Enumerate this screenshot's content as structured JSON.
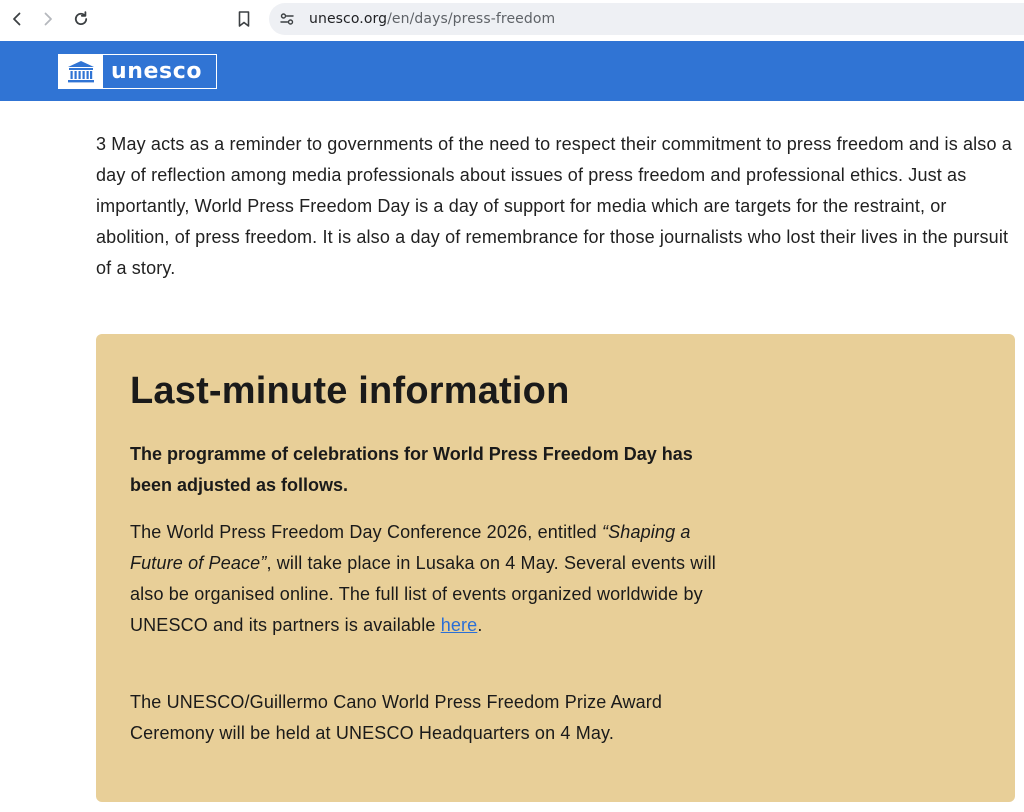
{
  "browser": {
    "url_domain": "unesco.org",
    "url_path": "/en/days/press-freedom"
  },
  "header": {
    "logo_text": "unesco",
    "brand_color": "#3074d4"
  },
  "intro": {
    "text": "3 May acts as a reminder to governments of the need to respect their commitment to press freedom and is also a day of reflection among media professionals about issues of press freedom and professional ethics. Just as importantly, World Press Freedom Day is a day of support for media which are targets for the restraint, or abolition, of press freedom. It is also a day of remembrance for those journalists who lost their lives in the pursuit of a story."
  },
  "info": {
    "background_color": "#e8cf98",
    "title": "Last-minute information",
    "lead": "The programme of celebrations for World Press Freedom Day has been adjusted as follows.",
    "p1_before": "The World Press Freedom Day Conference 2026, entitled ",
    "p1_emphasis": "“Shaping a Future of Peace”",
    "p1_after": ", will take place in Lusaka on 4 May. Several events will also be organised online. The full list of events organized worldwide by UNESCO and its partners is available ",
    "p1_link": "here",
    "p1_end": ".",
    "p2": "The UNESCO/Guillermo Cano World Press Freedom Prize Award Ceremony will be held at UNESCO Headquarters on 4 May."
  }
}
